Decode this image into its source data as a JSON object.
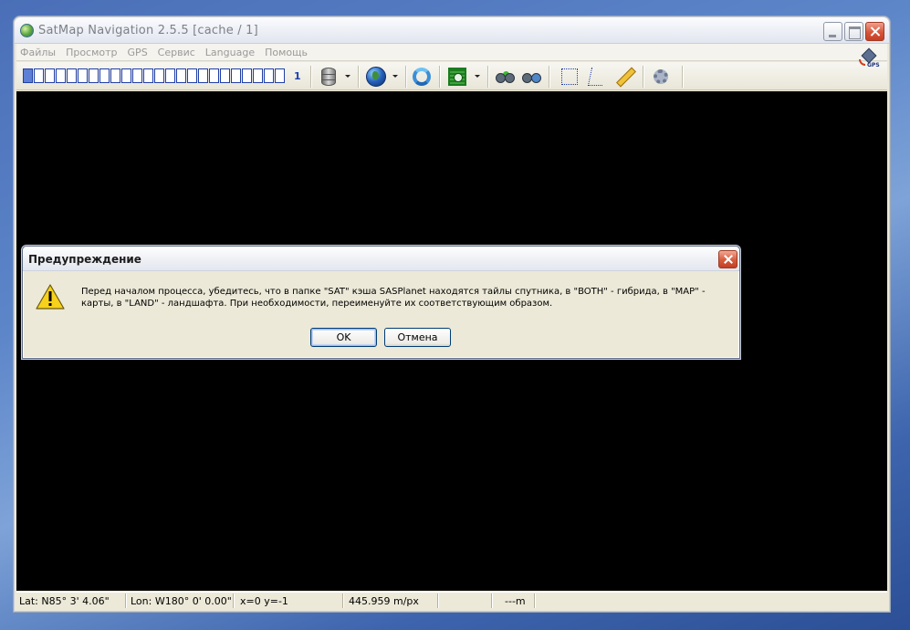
{
  "window": {
    "title": "SatMap Navigation 2.5.5  [cache / 1]"
  },
  "menu": {
    "items": [
      "Файлы",
      "Просмотр",
      "GPS",
      "Сервис",
      "Language",
      "Помощь"
    ]
  },
  "toolbar": {
    "zoom_level": "1",
    "zoom_segments_total": 24,
    "zoom_segments_active": 1,
    "icons": [
      "storage-icon",
      "globe-icon",
      "refresh-icon",
      "layer-icon",
      "binoculars-go-icon",
      "binoculars-earth-icon",
      "select-rect-icon",
      "select-polygon-icon",
      "ruler-icon",
      "settings-icon",
      "gps-icon"
    ],
    "gps_label": "GPS"
  },
  "statusbar": {
    "lat": "Lat: N85° 3' 4.06\"",
    "lon": "Lon: W180° 0' 0.00\"",
    "xy": "x=0 y=-1",
    "scale": "445.959 m/px",
    "distance": "---m"
  },
  "dialog": {
    "title": "Предупреждение",
    "message": "Перед началом процесса, убедитесь, что в папке \"SAT\" кэша SASPlanet находятся тайлы спутника, в \"BOTH\" - гибрида, в \"MAP\" - карты, в \"LAND\" - ландшафта. При необходимости, переименуйте их соответствующим образом.",
    "ok_label": "OK",
    "cancel_label": "Отмена",
    "icon": "warning-icon"
  },
  "colors": {
    "map_background": "#000000",
    "window_face": "#ece9d8",
    "accent_blue": "#1f3fa6"
  }
}
